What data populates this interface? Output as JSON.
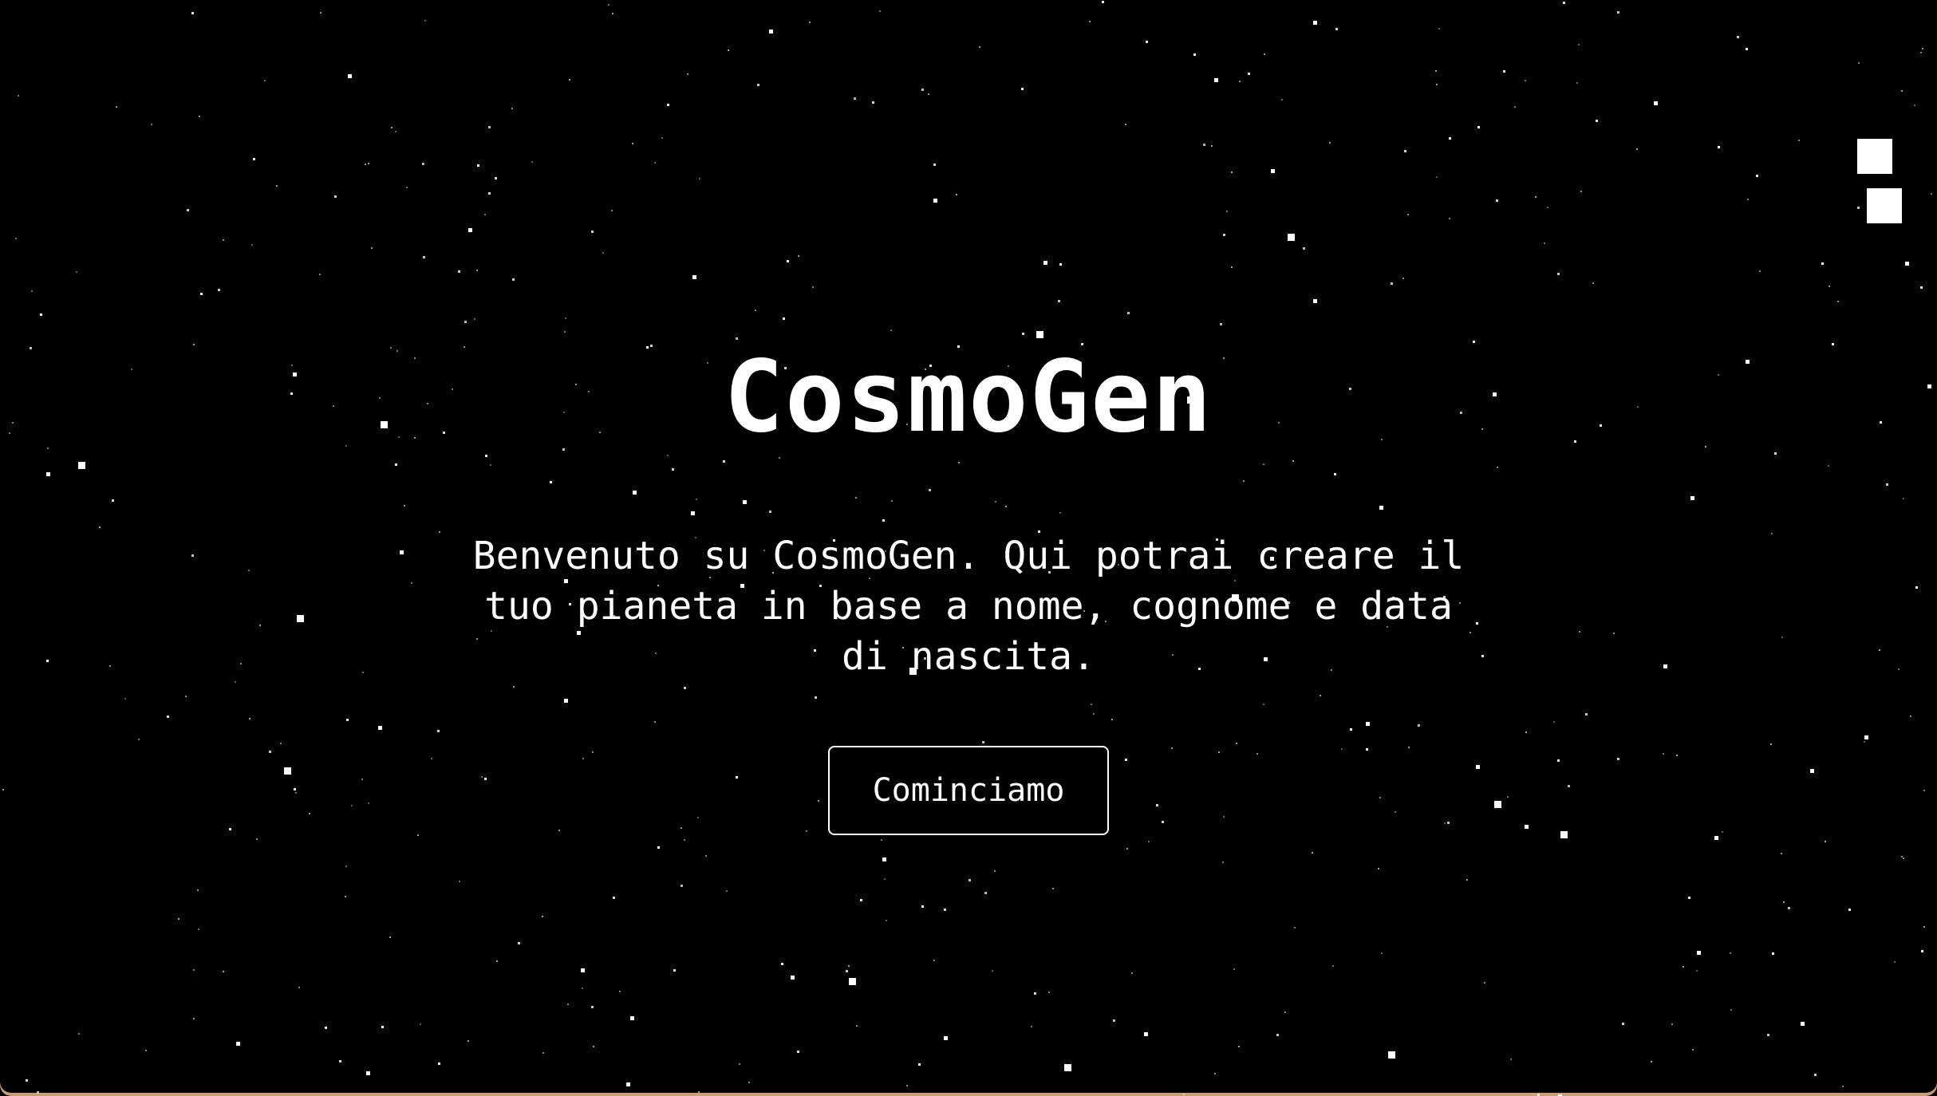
{
  "hero": {
    "title": "CosmoGen",
    "description": "Benvenuto su CosmoGen. Qui potrai creare il tuo pianeta in base a nome, cognome e data di nascita.",
    "start_label": "Cominciamo"
  },
  "menu": {
    "icon": "menu-squares-icon"
  },
  "colors": {
    "background": "#000000",
    "text": "#ffffff",
    "stars": "#ffffff"
  }
}
